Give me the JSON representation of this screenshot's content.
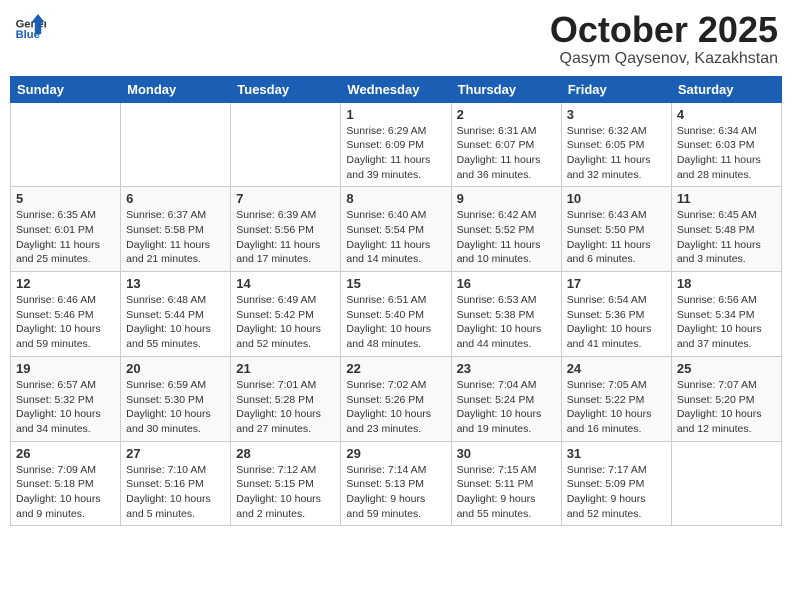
{
  "header": {
    "logo_general": "General",
    "logo_blue": "Blue",
    "month": "October 2025",
    "location": "Qasym Qaysenov, Kazakhstan"
  },
  "weekdays": [
    "Sunday",
    "Monday",
    "Tuesday",
    "Wednesday",
    "Thursday",
    "Friday",
    "Saturday"
  ],
  "weeks": [
    [
      {
        "day": "",
        "info": ""
      },
      {
        "day": "",
        "info": ""
      },
      {
        "day": "",
        "info": ""
      },
      {
        "day": "1",
        "info": "Sunrise: 6:29 AM\nSunset: 6:09 PM\nDaylight: 11 hours\nand 39 minutes."
      },
      {
        "day": "2",
        "info": "Sunrise: 6:31 AM\nSunset: 6:07 PM\nDaylight: 11 hours\nand 36 minutes."
      },
      {
        "day": "3",
        "info": "Sunrise: 6:32 AM\nSunset: 6:05 PM\nDaylight: 11 hours\nand 32 minutes."
      },
      {
        "day": "4",
        "info": "Sunrise: 6:34 AM\nSunset: 6:03 PM\nDaylight: 11 hours\nand 28 minutes."
      }
    ],
    [
      {
        "day": "5",
        "info": "Sunrise: 6:35 AM\nSunset: 6:01 PM\nDaylight: 11 hours\nand 25 minutes."
      },
      {
        "day": "6",
        "info": "Sunrise: 6:37 AM\nSunset: 5:58 PM\nDaylight: 11 hours\nand 21 minutes."
      },
      {
        "day": "7",
        "info": "Sunrise: 6:39 AM\nSunset: 5:56 PM\nDaylight: 11 hours\nand 17 minutes."
      },
      {
        "day": "8",
        "info": "Sunrise: 6:40 AM\nSunset: 5:54 PM\nDaylight: 11 hours\nand 14 minutes."
      },
      {
        "day": "9",
        "info": "Sunrise: 6:42 AM\nSunset: 5:52 PM\nDaylight: 11 hours\nand 10 minutes."
      },
      {
        "day": "10",
        "info": "Sunrise: 6:43 AM\nSunset: 5:50 PM\nDaylight: 11 hours\nand 6 minutes."
      },
      {
        "day": "11",
        "info": "Sunrise: 6:45 AM\nSunset: 5:48 PM\nDaylight: 11 hours\nand 3 minutes."
      }
    ],
    [
      {
        "day": "12",
        "info": "Sunrise: 6:46 AM\nSunset: 5:46 PM\nDaylight: 10 hours\nand 59 minutes."
      },
      {
        "day": "13",
        "info": "Sunrise: 6:48 AM\nSunset: 5:44 PM\nDaylight: 10 hours\nand 55 minutes."
      },
      {
        "day": "14",
        "info": "Sunrise: 6:49 AM\nSunset: 5:42 PM\nDaylight: 10 hours\nand 52 minutes."
      },
      {
        "day": "15",
        "info": "Sunrise: 6:51 AM\nSunset: 5:40 PM\nDaylight: 10 hours\nand 48 minutes."
      },
      {
        "day": "16",
        "info": "Sunrise: 6:53 AM\nSunset: 5:38 PM\nDaylight: 10 hours\nand 44 minutes."
      },
      {
        "day": "17",
        "info": "Sunrise: 6:54 AM\nSunset: 5:36 PM\nDaylight: 10 hours\nand 41 minutes."
      },
      {
        "day": "18",
        "info": "Sunrise: 6:56 AM\nSunset: 5:34 PM\nDaylight: 10 hours\nand 37 minutes."
      }
    ],
    [
      {
        "day": "19",
        "info": "Sunrise: 6:57 AM\nSunset: 5:32 PM\nDaylight: 10 hours\nand 34 minutes."
      },
      {
        "day": "20",
        "info": "Sunrise: 6:59 AM\nSunset: 5:30 PM\nDaylight: 10 hours\nand 30 minutes."
      },
      {
        "day": "21",
        "info": "Sunrise: 7:01 AM\nSunset: 5:28 PM\nDaylight: 10 hours\nand 27 minutes."
      },
      {
        "day": "22",
        "info": "Sunrise: 7:02 AM\nSunset: 5:26 PM\nDaylight: 10 hours\nand 23 minutes."
      },
      {
        "day": "23",
        "info": "Sunrise: 7:04 AM\nSunset: 5:24 PM\nDaylight: 10 hours\nand 19 minutes."
      },
      {
        "day": "24",
        "info": "Sunrise: 7:05 AM\nSunset: 5:22 PM\nDaylight: 10 hours\nand 16 minutes."
      },
      {
        "day": "25",
        "info": "Sunrise: 7:07 AM\nSunset: 5:20 PM\nDaylight: 10 hours\nand 12 minutes."
      }
    ],
    [
      {
        "day": "26",
        "info": "Sunrise: 7:09 AM\nSunset: 5:18 PM\nDaylight: 10 hours\nand 9 minutes."
      },
      {
        "day": "27",
        "info": "Sunrise: 7:10 AM\nSunset: 5:16 PM\nDaylight: 10 hours\nand 5 minutes."
      },
      {
        "day": "28",
        "info": "Sunrise: 7:12 AM\nSunset: 5:15 PM\nDaylight: 10 hours\nand 2 minutes."
      },
      {
        "day": "29",
        "info": "Sunrise: 7:14 AM\nSunset: 5:13 PM\nDaylight: 9 hours\nand 59 minutes."
      },
      {
        "day": "30",
        "info": "Sunrise: 7:15 AM\nSunset: 5:11 PM\nDaylight: 9 hours\nand 55 minutes."
      },
      {
        "day": "31",
        "info": "Sunrise: 7:17 AM\nSunset: 5:09 PM\nDaylight: 9 hours\nand 52 minutes."
      },
      {
        "day": "",
        "info": ""
      }
    ]
  ]
}
